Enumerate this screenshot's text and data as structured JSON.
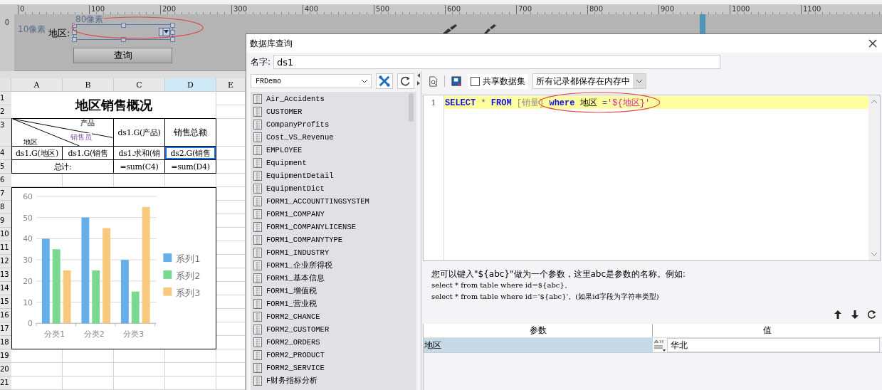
{
  "ruler": {
    "marks": [
      "0",
      "100",
      "200",
      "300",
      "400",
      "500",
      "600",
      "700",
      "800",
      "900",
      "1000",
      "1100"
    ]
  },
  "vertical_ruler": {
    "mark": "0"
  },
  "form": {
    "hint_left": "10像素",
    "hint_top": "80像素",
    "label": "地区:",
    "button": "查询"
  },
  "sheet": {
    "columns": [
      {
        "label": "A",
        "selected": false
      },
      {
        "label": "B",
        "selected": false
      },
      {
        "label": "C",
        "selected": false
      },
      {
        "label": "D",
        "selected": true
      },
      {
        "label": "E",
        "selected": false
      }
    ],
    "rows": [
      "1",
      "2",
      "3",
      "4",
      "5",
      "6",
      "7",
      "8",
      "9",
      "10",
      "11",
      "12",
      "13",
      "14",
      "15",
      "16",
      "17",
      "18",
      "19",
      "20",
      "21"
    ],
    "title": "地区销售概况",
    "corner": {
      "top": "产品",
      "middle": "销售员",
      "bottom": "地区"
    },
    "header": [
      "ds1.G(产品)",
      "销售总额"
    ],
    "data_row": [
      {
        "text": "ds1.G(地区)",
        "selected": false
      },
      {
        "text": "ds1.G(销售",
        "selected": false
      },
      {
        "text": "ds1.求和(销",
        "selected": false
      },
      {
        "text": "ds2.G(销售",
        "selected": true
      }
    ],
    "total_row": [
      "总计:",
      "=sum(C4)",
      "=sum(D4)"
    ],
    "chart": {
      "chart_data": {
        "type": "bar",
        "categories": [
          "分类1",
          "分类2",
          "分类3"
        ],
        "series": [
          {
            "name": "系列1",
            "color": "#64aee9",
            "values": [
              40,
              50,
              30
            ]
          },
          {
            "name": "系列2",
            "color": "#79d98e",
            "values": [
              35,
              25,
              15
            ]
          },
          {
            "name": "系列3",
            "color": "#f8c97d",
            "values": [
              25,
              45,
              55
            ]
          }
        ],
        "ylim": [
          0,
          60
        ],
        "yticks": [
          0,
          10,
          20,
          30,
          40,
          50,
          60
        ],
        "grid": true,
        "legend": true
      }
    }
  },
  "dialog": {
    "title": "数据库查询",
    "name_label": "名字:",
    "name_value": "ds1",
    "connection": "FRDemo",
    "tables": [
      "Air_Accidents",
      "CUSTOMER",
      "CompanyProfits",
      "Cost_VS_Revenue",
      "EMPLOYEE",
      "Equipment",
      "EquipmentDetail",
      "EquipmentDict",
      "FORM1_ACCOUNTTINGSYSTEM",
      "FORM1_COMPANY",
      "FORM1_COMPANYLICENSE",
      "FORM1_COMPANYTYPE",
      "FORM1_INDUSTRY",
      "FORM1_企业所得税",
      "FORM1_基本信息",
      "FORM1_增值税",
      "FORM1_营业税",
      "FORM2_CHANCE",
      "FORM2_CUSTOMER",
      "FORM2_ORDERS",
      "FORM2_PRODUCT",
      "FORM2_SERVICE",
      "F财务指标分析"
    ],
    "share_dataset": {
      "label": "共享数据集",
      "checked": false
    },
    "storage_mode": "所有记录都保存在内存中",
    "sql": {
      "line_numbers": [
        "1"
      ],
      "tokens": [
        {
          "text": "SELECT",
          "kind": "keyword"
        },
        {
          "text": " * ",
          "kind": "operator"
        },
        {
          "text": "FROM",
          "kind": "keyword"
        },
        {
          "text": " [销量] ",
          "kind": "table"
        }
      ],
      "circled_tokens": [
        {
          "text": "where",
          "kind": "keyword"
        },
        {
          "text": " 地区 ",
          "kind": "plain"
        },
        {
          "text": "=",
          "kind": "operator"
        },
        {
          "text": "'${地区}'",
          "kind": "string"
        }
      ]
    },
    "hint": [
      "您可以键入\"${abc}\"做为一个参数，这里abc是参数的名称。例如:",
      "select * from table where id=${abc}。",
      "select * from table where id='${abc}'。(如果id字段为字符串类型)"
    ],
    "params": {
      "columns": [
        "参数",
        "值"
      ],
      "rows": [
        {
          "name": "地区",
          "value": "华北",
          "selected": true
        }
      ]
    }
  }
}
